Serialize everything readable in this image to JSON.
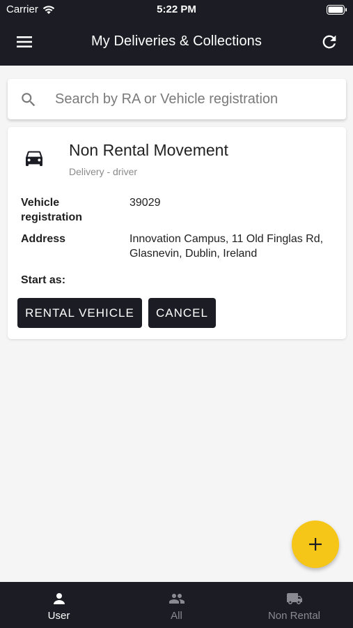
{
  "status_bar": {
    "carrier": "Carrier",
    "time": "5:22 PM"
  },
  "header": {
    "title": "My Deliveries & Collections",
    "menu_icon": "hamburger-menu-icon",
    "refresh_icon": "refresh-icon"
  },
  "search": {
    "placeholder": "Search by RA or Vehicle registration",
    "value": ""
  },
  "card": {
    "title": "Non Rental Movement",
    "subtitle": "Delivery - driver",
    "fields": [
      {
        "label": "Vehicle registration",
        "value": "39029"
      },
      {
        "label": "Address",
        "value": "Innovation Campus, 11 Old Finglas Rd, Glasnevin, Dublin, Ireland"
      }
    ],
    "start_label": "Start as:",
    "buttons": {
      "rental": "RENTAL VEHICLE",
      "cancel": "CANCEL"
    }
  },
  "fab": {
    "icon": "plus-icon"
  },
  "bottom_nav": {
    "items": [
      {
        "label": "User",
        "icon": "user-icon",
        "active": true
      },
      {
        "label": "All",
        "icon": "group-icon",
        "active": false
      },
      {
        "label": "Non Rental",
        "icon": "truck-icon",
        "active": false
      }
    ]
  },
  "colors": {
    "dark": "#1c1c24",
    "accent": "#f5c518",
    "background": "#f5f5f5"
  }
}
